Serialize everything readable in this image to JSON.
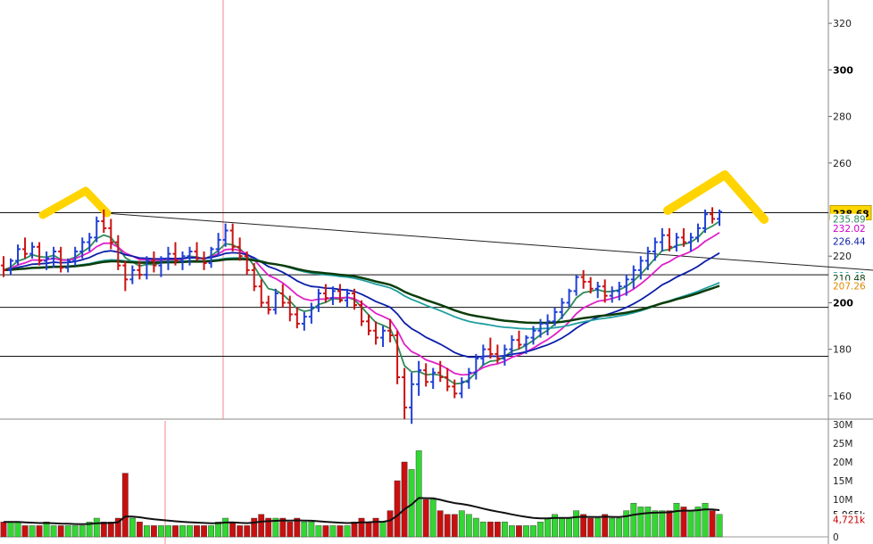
{
  "chart_data": {
    "type": "candlestick",
    "ylim": [
      150,
      330
    ],
    "volume_ylim": [
      0,
      30
    ],
    "price_ticks": [
      {
        "label": "320",
        "value": 320,
        "major": false
      },
      {
        "label": "300",
        "value": 300,
        "major": true
      },
      {
        "label": "280",
        "value": 280,
        "major": false
      },
      {
        "label": "260",
        "value": 260,
        "major": false
      },
      {
        "label": "220",
        "value": 220,
        "major": false
      },
      {
        "label": "200",
        "value": 200,
        "major": true
      },
      {
        "label": "180",
        "value": 180,
        "major": false
      },
      {
        "label": "160",
        "value": 160,
        "major": false
      }
    ],
    "volume_ticks": [
      {
        "label": "30M",
        "value": 30
      },
      {
        "label": "25M",
        "value": 25
      },
      {
        "label": "20M",
        "value": 20
      },
      {
        "label": "15M",
        "value": 15
      },
      {
        "label": "10M",
        "value": 10
      },
      {
        "label": "0",
        "value": 0
      }
    ],
    "price_tags": [
      {
        "label": "238.68",
        "value": 238.68,
        "color": "#000000",
        "bg": "#ffd700"
      },
      {
        "label": "235.89",
        "value": 235.89,
        "color": "#2e8b57",
        "bg": "#ffffff"
      },
      {
        "label": "232.02",
        "value": 232.02,
        "color": "#cc00cc",
        "bg": "#ffffff"
      },
      {
        "label": "226.44",
        "value": 226.44,
        "color": "#0a1ea8",
        "bg": "#ffffff"
      },
      {
        "label": "211.61",
        "value": 211.61,
        "color": "#1f9e9e",
        "bg": "#ffffff"
      },
      {
        "label": "210.48",
        "value": 210.48,
        "color": "#0b3d0b",
        "bg": "#ffffff"
      },
      {
        "label": "207.26",
        "value": 207.26,
        "color": "#e08a00",
        "bg": "#ffffff"
      }
    ],
    "volume_tags": [
      {
        "label": "5,965k",
        "value": 6.0,
        "color": "#000000"
      },
      {
        "label": "4,721k",
        "value": 4.7,
        "color": "#cc0000"
      }
    ],
    "horizontal_lines": [
      238.68,
      212.0,
      198.0,
      177.0
    ],
    "trend_line": {
      "from": {
        "bar": 14,
        "price": 238.5
      },
      "to": {
        "bar": 130,
        "price": 212.0
      }
    },
    "up_color": "#1f3fd6",
    "down_color": "#cc1111",
    "vol_up_color": "#33d633",
    "vol_down_color": "#c81010",
    "ma_series": [
      {
        "color": "#2e8b57",
        "period": 5
      },
      {
        "color": "#e020c8",
        "period": 10
      },
      {
        "color": "#0a1ea8",
        "period": 20
      },
      {
        "color": "#1f9e9e",
        "period": 50
      },
      {
        "color": "#e08a00",
        "period": 100
      },
      {
        "color": "#0b3d0b",
        "period": 200
      }
    ],
    "ohlc": [
      [
        216,
        220,
        211,
        214,
        4
      ],
      [
        214,
        219,
        212,
        218,
        4
      ],
      [
        218,
        225,
        216,
        223,
        4
      ],
      [
        223,
        228,
        219,
        221,
        3
      ],
      [
        221,
        226,
        219,
        224,
        3
      ],
      [
        224,
        226,
        216,
        218,
        3
      ],
      [
        218,
        222,
        214,
        219,
        4
      ],
      [
        219,
        224,
        215,
        222,
        3
      ],
      [
        222,
        224,
        213,
        215,
        3
      ],
      [
        215,
        219,
        213,
        218,
        3
      ],
      [
        218,
        224,
        216,
        222,
        3
      ],
      [
        222,
        228,
        219,
        226,
        3
      ],
      [
        226,
        230,
        222,
        228,
        4
      ],
      [
        228,
        237,
        226,
        235,
        5
      ],
      [
        235,
        240,
        230,
        232,
        4
      ],
      [
        232,
        236,
        223,
        226,
        4
      ],
      [
        226,
        229,
        214,
        216,
        5
      ],
      [
        216,
        218,
        205,
        210,
        17
      ],
      [
        210,
        216,
        208,
        214,
        5
      ],
      [
        214,
        218,
        210,
        212,
        4
      ],
      [
        212,
        220,
        210,
        218,
        3
      ],
      [
        218,
        222,
        213,
        216,
        3
      ],
      [
        216,
        220,
        211,
        219,
        3
      ],
      [
        219,
        224,
        214,
        221,
        3
      ],
      [
        221,
        226,
        216,
        218,
        3
      ],
      [
        218,
        222,
        214,
        220,
        3
      ],
      [
        220,
        224,
        216,
        222,
        3
      ],
      [
        222,
        226,
        218,
        219,
        3
      ],
      [
        219,
        222,
        214,
        217,
        3
      ],
      [
        217,
        224,
        215,
        223,
        3
      ],
      [
        223,
        230,
        220,
        227,
        4
      ],
      [
        227,
        234,
        224,
        231,
        5
      ],
      [
        231,
        234,
        222,
        224,
        4
      ],
      [
        224,
        228,
        218,
        220,
        3
      ],
      [
        220,
        222,
        212,
        214,
        3
      ],
      [
        214,
        217,
        205,
        207,
        5
      ],
      [
        207,
        210,
        198,
        200,
        6
      ],
      [
        200,
        203,
        195,
        197,
        5
      ],
      [
        197,
        206,
        195,
        204,
        5
      ],
      [
        204,
        208,
        198,
        200,
        5
      ],
      [
        200,
        203,
        192,
        195,
        4
      ],
      [
        195,
        198,
        189,
        191,
        5
      ],
      [
        191,
        196,
        188,
        194,
        4
      ],
      [
        194,
        200,
        191,
        198,
        4
      ],
      [
        198,
        206,
        196,
        204,
        3
      ],
      [
        204,
        208,
        200,
        202,
        3
      ],
      [
        202,
        207,
        199,
        205,
        3
      ],
      [
        205,
        208,
        200,
        201,
        3
      ],
      [
        201,
        206,
        198,
        204,
        3
      ],
      [
        204,
        206,
        197,
        199,
        4
      ],
      [
        199,
        201,
        190,
        192,
        5
      ],
      [
        192,
        195,
        186,
        188,
        4
      ],
      [
        188,
        192,
        182,
        185,
        5
      ],
      [
        185,
        190,
        181,
        188,
        4
      ],
      [
        188,
        193,
        183,
        186,
        7
      ],
      [
        186,
        188,
        165,
        168,
        15
      ],
      [
        168,
        172,
        150,
        155,
        20
      ],
      [
        155,
        170,
        148,
        165,
        18
      ],
      [
        165,
        175,
        160,
        171,
        23
      ],
      [
        171,
        174,
        164,
        166,
        10
      ],
      [
        166,
        172,
        163,
        170,
        10
      ],
      [
        170,
        175,
        166,
        168,
        7
      ],
      [
        168,
        172,
        162,
        164,
        6
      ],
      [
        164,
        167,
        159,
        161,
        6
      ],
      [
        161,
        168,
        159,
        166,
        7
      ],
      [
        166,
        172,
        163,
        170,
        6
      ],
      [
        170,
        178,
        167,
        176,
        5
      ],
      [
        176,
        182,
        173,
        180,
        4
      ],
      [
        180,
        185,
        176,
        178,
        4
      ],
      [
        178,
        182,
        174,
        176,
        4
      ],
      [
        176,
        182,
        173,
        180,
        4
      ],
      [
        180,
        186,
        177,
        184,
        3
      ],
      [
        184,
        188,
        180,
        182,
        3
      ],
      [
        182,
        186,
        178,
        185,
        3
      ],
      [
        185,
        190,
        182,
        188,
        3
      ],
      [
        188,
        193,
        185,
        191,
        4
      ],
      [
        191,
        195,
        186,
        192,
        5
      ],
      [
        192,
        198,
        190,
        196,
        6
      ],
      [
        196,
        202,
        193,
        200,
        5
      ],
      [
        200,
        206,
        198,
        205,
        5
      ],
      [
        205,
        212,
        203,
        211,
        7
      ],
      [
        211,
        214,
        206,
        209,
        6
      ],
      [
        209,
        211,
        204,
        206,
        5
      ],
      [
        206,
        209,
        202,
        207,
        5
      ],
      [
        207,
        210,
        200,
        203,
        6
      ],
      [
        203,
        207,
        200,
        205,
        5
      ],
      [
        205,
        209,
        201,
        207,
        5
      ],
      [
        207,
        212,
        203,
        210,
        7
      ],
      [
        210,
        216,
        206,
        214,
        9
      ],
      [
        214,
        220,
        210,
        218,
        8
      ],
      [
        218,
        224,
        214,
        222,
        8
      ],
      [
        222,
        228,
        218,
        226,
        7
      ],
      [
        226,
        232,
        222,
        229,
        7
      ],
      [
        229,
        232,
        222,
        224,
        7
      ],
      [
        224,
        230,
        222,
        228,
        9
      ],
      [
        228,
        232,
        224,
        226,
        8
      ],
      [
        226,
        230,
        222,
        228,
        7
      ],
      [
        228,
        234,
        226,
        232,
        8
      ],
      [
        232,
        240,
        230,
        238,
        9
      ],
      [
        238,
        241,
        234,
        236,
        7
      ],
      [
        236,
        240,
        233,
        239,
        6
      ]
    ]
  }
}
